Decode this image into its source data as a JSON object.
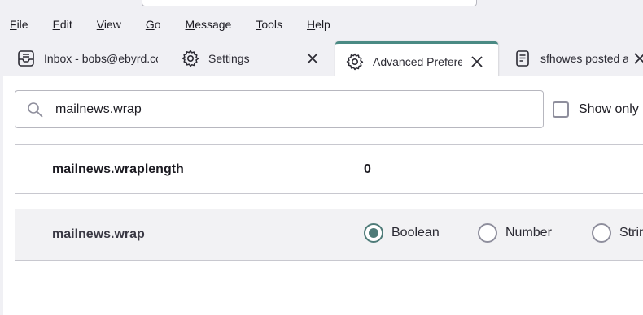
{
  "menubar": {
    "items": [
      {
        "accel": "F",
        "rest": "ile"
      },
      {
        "accel": "E",
        "rest": "dit"
      },
      {
        "accel": "V",
        "rest": "iew"
      },
      {
        "accel": "G",
        "rest": "o"
      },
      {
        "accel": "M",
        "rest": "essage"
      },
      {
        "accel": "T",
        "rest": "ools"
      },
      {
        "accel": "H",
        "rest": "elp"
      }
    ]
  },
  "tabs": [
    {
      "label": "Inbox - bobs@ebyrd.co",
      "icon": "inbox-icon"
    },
    {
      "label": "Settings",
      "icon": "gear-icon"
    },
    {
      "label": "Advanced Prefere",
      "icon": "gear-icon",
      "active": true
    },
    {
      "label": "sfhowes posted a",
      "icon": "document-icon"
    }
  ],
  "search": {
    "value": "mailnews.wrap"
  },
  "show_only": {
    "label": "Show only",
    "checked": false
  },
  "prefs": [
    {
      "name": "mailnews.wraplength",
      "value": "0"
    },
    {
      "name": "mailnews.wrap",
      "types": [
        "Boolean",
        "Number",
        "Strin"
      ],
      "selected": "Boolean"
    }
  ],
  "colors": {
    "accent": "#4e7b78",
    "active_tab_line": "#4a8a84"
  }
}
